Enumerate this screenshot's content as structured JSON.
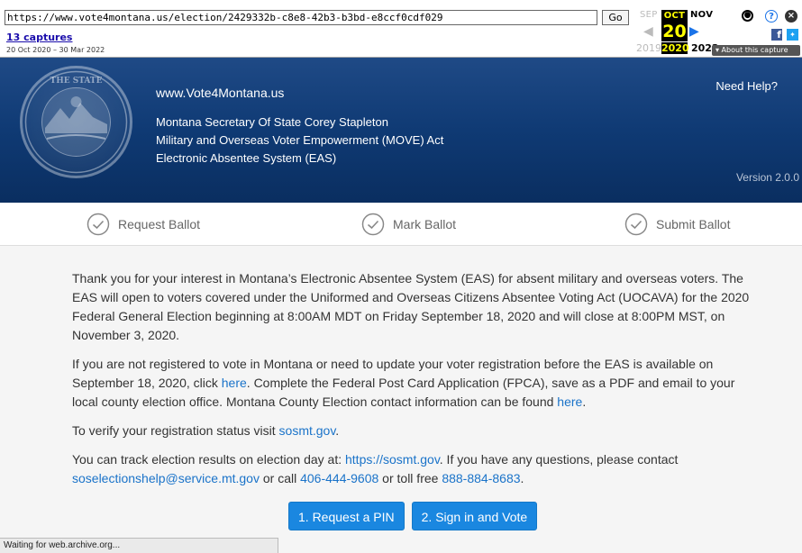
{
  "wayback": {
    "url": "https://www.vote4montana.us/election/2429332b-c8e8-42b3-b3bd-e8ccf0cdf029",
    "go_label": "Go",
    "captures_label": "13 captures",
    "date_range": "20 Oct 2020 – 30 Mar 2022",
    "month_prev": "SEP",
    "month_current": "OCT",
    "month_next": "NOV",
    "day_current": "20",
    "year_prev": "2019",
    "year_current": "2020",
    "year_next": "2022",
    "about_label": "▾ About this capture"
  },
  "header": {
    "site": "www.Vote4Montana.us",
    "line1": "Montana Secretary Of State Corey Stapleton",
    "line2": "Military and Overseas Voter Empowerment (MOVE) Act",
    "line3": "Electronic Absentee System (EAS)",
    "help": "Need Help?",
    "version": "Version 2.0.0"
  },
  "steps": [
    {
      "label": "Request Ballot"
    },
    {
      "label": "Mark Ballot"
    },
    {
      "label": "Submit Ballot"
    }
  ],
  "content": {
    "p1": "Thank you for your interest in Montana’s Electronic Absentee System (EAS) for absent military and overseas voters. The EAS will open to voters covered under the Uniformed and Overseas Citizens Absentee Voting Act (UOCAVA) for the 2020 Federal General Election beginning at 8:00AM MDT on Friday September 18, 2020 and will close at 8:00PM MST, on November 3, 2020.",
    "p2_a": "If you are not registered to vote in Montana or need to update your voter registration before the EAS is available on September 18, 2020, click ",
    "p2_link1": "here",
    "p2_b": ". Complete the Federal Post Card Application (FPCA), save as a PDF and email to your local county election office. Montana County Election contact information can be found ",
    "p2_link2": "here",
    "p2_c": ".",
    "p3_a": "To verify your registration status visit ",
    "p3_link": "sosmt.gov",
    "p3_b": ".",
    "p4_a": "You can track election results on election day at: ",
    "p4_link1": "https://sosmt.gov",
    "p4_b": ". If you have any questions, please contact ",
    "p4_link2": "soselectionshelp@service.mt.gov",
    "p4_c": " or call ",
    "p4_link3": "406-444-9608",
    "p4_d": " or toll free ",
    "p4_link4": "888-884-8683",
    "p4_e": "."
  },
  "buttons": {
    "request_pin": "1. Request a PIN",
    "sign_in": "2. Sign in and Vote"
  },
  "status_text": "Waiting for web.archive.org...",
  "colors": {
    "header_bg": "#0f3a74",
    "link": "#1a73c9",
    "button": "#1a87e0"
  }
}
